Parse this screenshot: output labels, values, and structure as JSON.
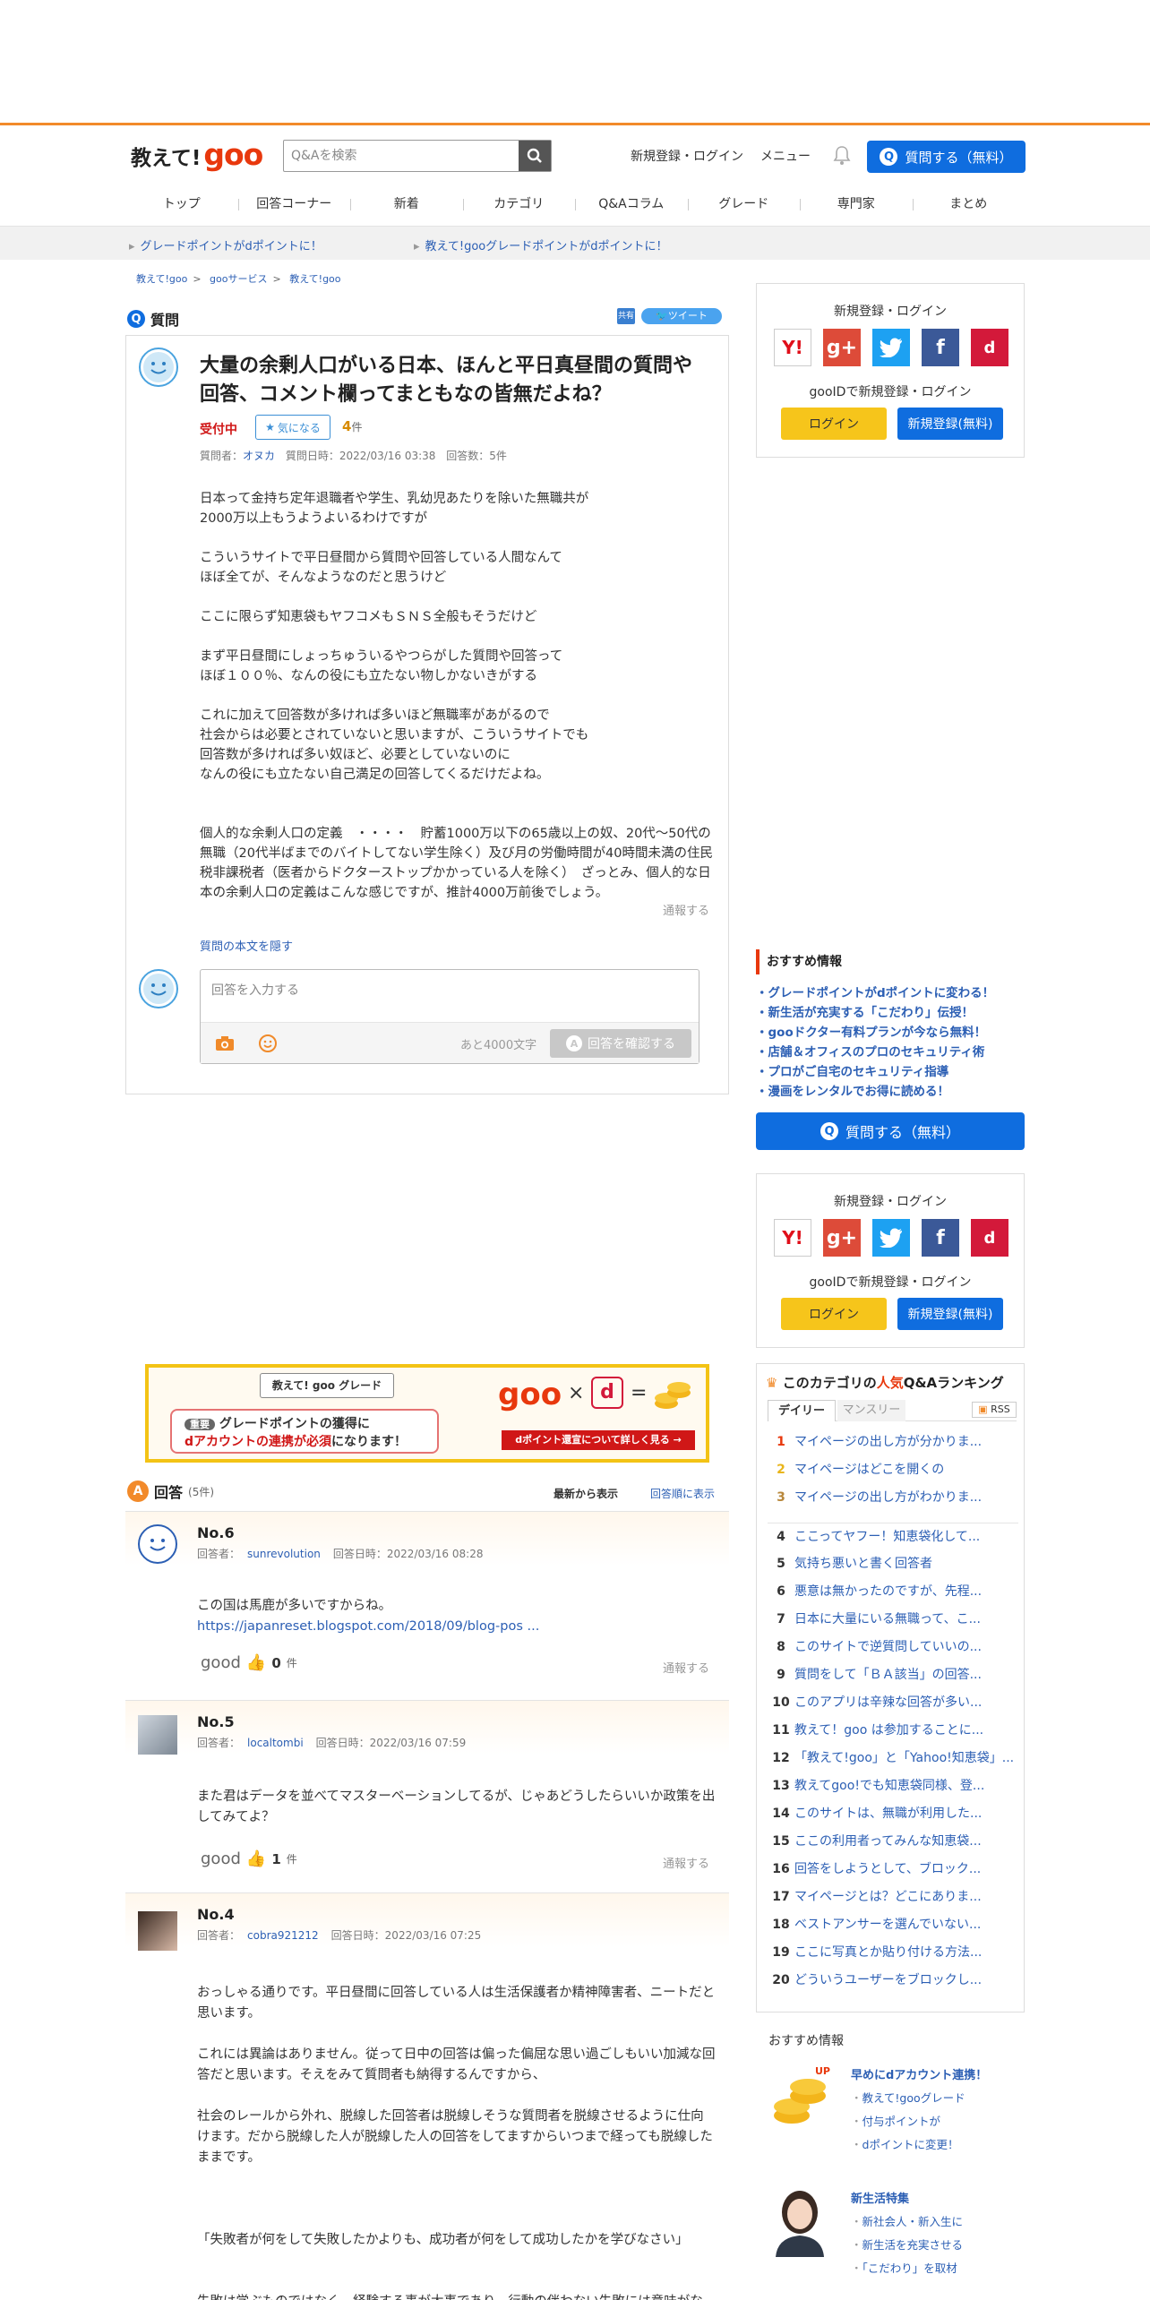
{
  "header": {
    "logo_text1": "教えて!",
    "logo_text2": "goo",
    "search_placeholder": "Q&Aを検索",
    "login_link": "新規登録・ログイン",
    "menu_link": "メニュー",
    "ask_button": "質問する（無料）",
    "ask_icon": "Q"
  },
  "gnav": [
    "トップ",
    "回答コーナー",
    "新着",
    "カテゴリ",
    "Q&Aコラム",
    "グレード",
    "専門家",
    "まとめ"
  ],
  "notice_bar": [
    "グレードポイントがdポイントに！",
    "教えて!gooグレードポイントがdポイントに！"
  ],
  "breadcrumb": [
    "教えて!goo",
    "gooサービス",
    "教えて!goo"
  ],
  "question": {
    "section_label": "質問",
    "section_icon": "Q",
    "share_label": "共有",
    "tweet_label": "ツイート",
    "title": "大量の余剰人口がいる日本、ほんと平日真昼間の質問や回答、コメント欄ってまともなの皆無だよね？",
    "status": "受付中",
    "watch_label": "気になる",
    "watch_count": "4",
    "watch_unit": "件",
    "asker_label": "質問者：",
    "asker": "オヌカ",
    "date_label": "質問日時：2022/03/16 03:38",
    "answers_label": "回答数：5件",
    "body": "日本って金持ち定年退職者や学生、乳幼児あたりを除いた無職共が\n2000万以上もうようよいるわけですが\n\nこういうサイトで平日昼間から質問や回答している人間なんて\nほぼ全てが、そんなようなのだと思うけど\n\nここに限らず知恵袋もヤフコメもＳＮＳ全般もそうだけど\n\nまず平日昼間にしょっちゅういるやつらがした質問や回答って\nほぼ１００％、なんの役にも立たない物しかないきがする\n\nこれに加えて回答数が多ければ多いほど無職率があがるので\n社会からは必要とされていないと思いますが、こういうサイトでも\n回答数が多ければ多い奴ほど、必要としていないのに\nなんの役にも立たない自己満足の回答してくるだけだよね。\n\n\n個人的な余剰人口の定義　・・・・　貯蓄1000万以下の65歳以上の奴、20代～50代の無職（20代半ばまでのバイトしてない学生除く）及び月の労働時間が40時間未満の住民税非課税者（医者からドクターストップかかっている人を除く）　ざっとみ、個人的な日本の余剰人口の定義はこんな感じですが、推計4000万前後でしょう。",
    "report": "通報する",
    "hide_body": "質問の本文を隠す",
    "answer_placeholder": "回答を入力する",
    "remaining": "あと4000文字",
    "confirm_button": "回答を確認する",
    "confirm_icon": "A"
  },
  "sidebar_login": {
    "title": "新規登録・ログイン",
    "goo_id": "gooIDで新規登録・ログイン",
    "login": "ログイン",
    "register": "新規登録(無料)",
    "socials": [
      "Y!",
      "g+",
      "",
      "f",
      "d"
    ]
  },
  "recommend": {
    "title": "おすすめ情報",
    "items": [
      "グレードポイントがdポイントに変わる！",
      "新生活が充実する「こだわり」伝授！",
      "gooドクター有料プランが今なら無料！",
      "店舗＆オフィスのプロのセキュリティ術",
      "プロがご自宅のセキュリティ指導",
      "漫画をレンタルでお得に読める！"
    ],
    "ask_button": "質問する（無料）"
  },
  "banner": {
    "badge": "教えて! goo グレード",
    "line1_tag": "重要",
    "line1": "グレードポイントの獲得に",
    "line2a": "dアカウントの連携",
    "line2b": "が必須",
    "line2c": "になります！",
    "goo": "goo",
    "times": "×",
    "d": "d",
    "eq": "=",
    "cta": "dポイント還宣について詳しく見る →"
  },
  "answers_section": {
    "label": "回答",
    "count": "(5件)",
    "sort_new": "最新から表示",
    "sort_old": "回答順に表示",
    "icon": "A"
  },
  "answers": [
    {
      "no": "No.6",
      "answerer_label": "回答者：",
      "answerer": "sunrevolution",
      "date": "回答日時：2022/03/16 08:28",
      "text": "この国は馬鹿が多いですからね。",
      "link": "https://japanreset.blogspot.com/2018/09/blog-pos ...",
      "good_label": "good",
      "good_count": "0",
      "unit": "件",
      "report": "通報する"
    },
    {
      "no": "No.5",
      "answerer_label": "回答者：",
      "answerer": "localtombi",
      "date": "回答日時：2022/03/16 07:59",
      "text": "また君はデータを並べてマスターベーションしてるが、じゃあどうしたらいいか政策を出してみてよ？",
      "good_label": "good",
      "good_count": "1",
      "unit": "件",
      "report": "通報する"
    },
    {
      "no": "No.4",
      "answerer_label": "回答者：",
      "answerer": "cobra921212",
      "date": "回答日時：2022/03/16 07:25",
      "text": "おっしゃる通りです。平日昼間に回答している人は生活保護者か精神障害者、ニートだと思います。\n\nこれには異論はありません。従って日中の回答は偏った偏屈な思い過ごしもいい加減な回答だと思います。そえをみて質問者も納得するんですから、\n\n社会のレールから外れ、脱線した回答者は脱線しそうな質問者を脱線させるように仕向けます。だから脱線した人が脱線した人の回答をしてますからいつまで経っても脱線したままです。\n\n\n\n「失敗者が何をして失敗したかよりも、成功者が何をして成功したかを学びなさい」\n\n\n失敗は学ぶものではなく、経験する事が大事であり、行動の伴わない失敗には意味がない。間違いや失敗を犯したことのない者というのは、単に無難なこと、安全なこ"
    }
  ],
  "ranking": {
    "title_pre": "このカテゴリの",
    "title_hi": "人気",
    "title_post": "Q&Aランキング",
    "tab_daily": "デイリー",
    "tab_monthly": "マンスリー",
    "rss": "RSS",
    "items": [
      {
        "n": "1",
        "t": "マイページの出し方が分かりま..."
      },
      {
        "n": "2",
        "t": "マイページはどこを開くの"
      },
      {
        "n": "3",
        "t": "マイページの出し方がわかりま..."
      },
      {
        "n": "4",
        "t": "ここってヤフー！知恵袋化して..."
      },
      {
        "n": "5",
        "t": "気持ち悪いと書く回答者"
      },
      {
        "n": "6",
        "t": "悪意は無かったのですが、先程..."
      },
      {
        "n": "7",
        "t": "日本に大量にいる無職って、こ..."
      },
      {
        "n": "8",
        "t": "このサイトで逆質問していいの..."
      },
      {
        "n": "9",
        "t": "質問をして「ＢＡ該当」の回答..."
      },
      {
        "n": "10",
        "t": "このアプリは辛辣な回答が多い..."
      },
      {
        "n": "11",
        "t": "教えて！goo は参加することに..."
      },
      {
        "n": "12",
        "t": "「教えて!goo」と「Yahoo!知恵袋」..."
      },
      {
        "n": "13",
        "t": "教えてgoo!でも知恵袋同様、登..."
      },
      {
        "n": "14",
        "t": "このサイトは、無職が利用した..."
      },
      {
        "n": "15",
        "t": "ここの利用者ってみんな知恵袋..."
      },
      {
        "n": "16",
        "t": "回答をしようとして、ブロック..."
      },
      {
        "n": "17",
        "t": "マイページとは？どこにありま..."
      },
      {
        "n": "18",
        "t": "ベストアンサーを選んでいない..."
      },
      {
        "n": "19",
        "t": "ここに写真とか貼り付ける方法..."
      },
      {
        "n": "20",
        "t": "どういうユーザーをブロックし..."
      }
    ]
  },
  "osusume2": {
    "title": "おすすめ情報",
    "promo1": {
      "head": "早めにdアカウント連携！",
      "items": [
        "教えて!gooグレード",
        "付与ポイントが",
        "dポイントに変更！"
      ]
    },
    "promo2": {
      "head": "新生活特集",
      "items": [
        "新社会人・新入生に",
        "新生活を充実させる",
        "「こだわり」を取材"
      ]
    }
  },
  "colors": {
    "brand_orange": "#f28a2a",
    "goo_red": "#e8380d",
    "blue": "#0f6ddf",
    "link": "#2c5fb4"
  }
}
